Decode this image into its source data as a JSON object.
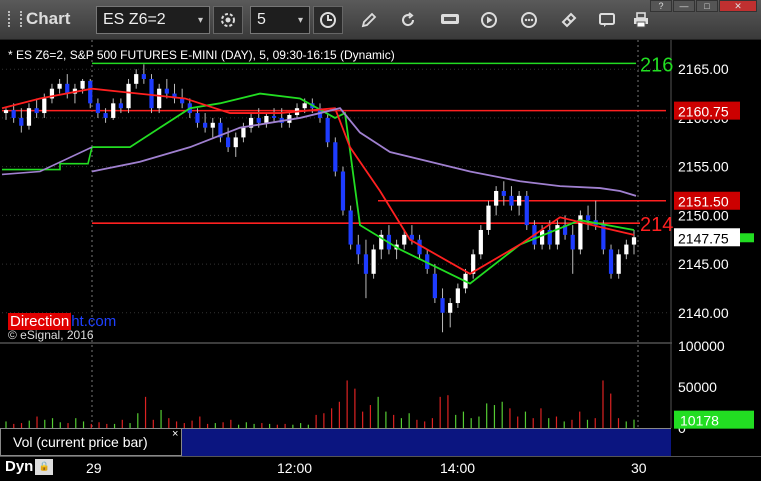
{
  "toolbar": {
    "title": "Chart",
    "symbol": "ES Z6=2",
    "interval": "5",
    "symbol_dropdown": "▾",
    "interval_dropdown": "▾"
  },
  "window_controls": {
    "help": "?",
    "minimize": "—",
    "maximize": "□",
    "close": "✕"
  },
  "legend": "* ES Z6=2, S&P 500 FUTURES E-MINI (DAY), 5, 09:30-16:15 (Dynamic)",
  "brand": {
    "part1": "Direction",
    "part2": "al.com",
    "overlay": "ht.com"
  },
  "copyright": "© eSignal, 2016",
  "price_axis": {
    "ticks": [
      "2165.00",
      "2160.00",
      "2155.00",
      "2150.00",
      "2145.00",
      "2140.00"
    ],
    "labels": [
      {
        "text": "2160.75",
        "color": "#e00000"
      },
      {
        "text": "2151.50",
        "color": "#e00000"
      },
      {
        "text": "2147.75",
        "color": "#ffffff"
      }
    ],
    "right_edge_labels": [
      {
        "text": "216",
        "color": "#22dd22"
      },
      {
        "text": "214",
        "color": "#ff2020"
      }
    ]
  },
  "volume_axis": {
    "ticks": [
      "100000",
      "50000",
      "0"
    ],
    "current": "10178"
  },
  "volume_tab": {
    "label": "Vol (current price bar)",
    "close": "×"
  },
  "bottom": {
    "dyn": "Dyn",
    "dyn_icon": "lock-icon",
    "x_labels": [
      "29",
      "12:00",
      "14:00",
      "30"
    ]
  },
  "colors": {
    "background": "#000000",
    "up_candle": "#ffffff",
    "down_candle": "#1e3cff",
    "red_line": "#ff2020",
    "green_line": "#22dd22",
    "purple_line": "#a080d0",
    "volume_tab_bar": "#0b1580"
  },
  "chart_data": {
    "type": "candlestick",
    "title": "ES Z6=2, S&P 500 FUTURES E-MINI (DAY), 5, 09:30-16:15 (Dynamic)",
    "ylim": [
      2137,
      2168
    ],
    "x_labels": [
      "29",
      "12:00",
      "14:00",
      "30"
    ],
    "horizontal_levels": [
      {
        "value": 2165.6,
        "color": "green"
      },
      {
        "value": 2160.75,
        "color": "red"
      },
      {
        "value": 2151.5,
        "color": "red"
      },
      {
        "value": 2149.2,
        "color": "red"
      }
    ],
    "last_price": 2147.75,
    "candles": [
      [
        2160.5,
        2161.0,
        2159.8,
        2160.8
      ],
      [
        2160.8,
        2161.5,
        2159.5,
        2160.0
      ],
      [
        2160.0,
        2161.0,
        2158.5,
        2159.2
      ],
      [
        2159.2,
        2161.5,
        2158.8,
        2161.0
      ],
      [
        2161.0,
        2162.0,
        2160.0,
        2160.5
      ],
      [
        2160.5,
        2162.5,
        2160.0,
        2162.0
      ],
      [
        2162.0,
        2163.5,
        2161.5,
        2163.0
      ],
      [
        2163.0,
        2164.0,
        2162.5,
        2163.5
      ],
      [
        2163.5,
        2164.5,
        2162.0,
        2162.5
      ],
      [
        2162.5,
        2163.5,
        2161.5,
        2163.0
      ],
      [
        2163.0,
        2164.0,
        2162.5,
        2163.8
      ],
      [
        2163.8,
        2164.0,
        2161.0,
        2161.5
      ],
      [
        2161.5,
        2162.0,
        2160.0,
        2160.5
      ],
      [
        2160.5,
        2161.0,
        2159.5,
        2160.0
      ],
      [
        2160.0,
        2162.0,
        2159.8,
        2161.5
      ],
      [
        2161.5,
        2162.0,
        2160.5,
        2161.0
      ],
      [
        2161.0,
        2164.0,
        2160.5,
        2163.5
      ],
      [
        2163.5,
        2165.0,
        2163.0,
        2164.5
      ],
      [
        2164.5,
        2165.5,
        2163.5,
        2164.0
      ],
      [
        2164.0,
        2164.5,
        2160.5,
        2161.0
      ],
      [
        2161.0,
        2163.5,
        2160.5,
        2163.0
      ],
      [
        2163.0,
        2164.0,
        2162.0,
        2162.5
      ],
      [
        2162.5,
        2163.5,
        2161.5,
        2162.0
      ],
      [
        2162.0,
        2163.0,
        2161.0,
        2161.5
      ],
      [
        2161.5,
        2162.0,
        2160.0,
        2160.5
      ],
      [
        2160.5,
        2161.0,
        2159.0,
        2159.5
      ],
      [
        2159.5,
        2160.5,
        2158.5,
        2159.0
      ],
      [
        2159.0,
        2160.0,
        2158.0,
        2159.5
      ],
      [
        2159.5,
        2160.0,
        2157.5,
        2158.0
      ],
      [
        2158.0,
        2159.0,
        2156.5,
        2157.0
      ],
      [
        2157.0,
        2158.5,
        2156.0,
        2158.0
      ],
      [
        2158.0,
        2159.5,
        2157.5,
        2159.0
      ],
      [
        2159.0,
        2160.5,
        2158.5,
        2160.0
      ],
      [
        2160.0,
        2161.0,
        2159.0,
        2159.5
      ],
      [
        2159.5,
        2160.5,
        2159.0,
        2160.2
      ],
      [
        2160.2,
        2161.0,
        2159.5,
        2160.0
      ],
      [
        2160.0,
        2161.0,
        2159.0,
        2159.5
      ],
      [
        2159.5,
        2160.5,
        2159.0,
        2160.3
      ],
      [
        2160.3,
        2161.5,
        2160.0,
        2161.0
      ],
      [
        2161.0,
        2162.0,
        2160.5,
        2161.5
      ],
      [
        2161.5,
        2162.0,
        2160.5,
        2161.0
      ],
      [
        2161.0,
        2161.5,
        2159.5,
        2160.0
      ],
      [
        2160.0,
        2160.5,
        2157.0,
        2157.5
      ],
      [
        2157.5,
        2158.0,
        2154.0,
        2154.5
      ],
      [
        2154.5,
        2155.0,
        2150.0,
        2150.5
      ],
      [
        2150.5,
        2151.0,
        2146.5,
        2147.0
      ],
      [
        2147.0,
        2148.0,
        2145.0,
        2146.0
      ],
      [
        2146.0,
        2147.5,
        2141.5,
        2144.0
      ],
      [
        2144.0,
        2147.0,
        2143.5,
        2146.5
      ],
      [
        2146.5,
        2148.5,
        2145.5,
        2148.0
      ],
      [
        2148.0,
        2149.0,
        2146.0,
        2146.5
      ],
      [
        2146.5,
        2147.5,
        2145.5,
        2147.0
      ],
      [
        2147.0,
        2148.5,
        2146.5,
        2148.0
      ],
      [
        2148.0,
        2149.0,
        2147.0,
        2147.5
      ],
      [
        2147.5,
        2148.0,
        2145.5,
        2146.0
      ],
      [
        2146.0,
        2146.5,
        2144.0,
        2144.5
      ],
      [
        2144.0,
        2145.0,
        2141.0,
        2141.5
      ],
      [
        2141.5,
        2142.5,
        2138.0,
        2140.0
      ],
      [
        2140.0,
        2141.5,
        2138.5,
        2141.0
      ],
      [
        2141.0,
        2143.0,
        2140.5,
        2142.5
      ],
      [
        2142.5,
        2144.5,
        2142.0,
        2144.0
      ],
      [
        2144.0,
        2146.5,
        2143.5,
        2146.0
      ],
      [
        2146.0,
        2149.0,
        2145.5,
        2148.5
      ],
      [
        2148.5,
        2151.5,
        2148.0,
        2151.0
      ],
      [
        2151.0,
        2153.0,
        2150.0,
        2152.5
      ],
      [
        2152.5,
        2153.5,
        2151.0,
        2152.0
      ],
      [
        2152.0,
        2153.0,
        2150.5,
        2151.0
      ],
      [
        2151.0,
        2152.5,
        2150.0,
        2152.0
      ],
      [
        2152.0,
        2152.5,
        2148.5,
        2149.0
      ],
      [
        2149.0,
        2149.5,
        2146.5,
        2147.0
      ],
      [
        2147.0,
        2149.0,
        2146.5,
        2148.5
      ],
      [
        2148.5,
        2149.5,
        2146.5,
        2147.0
      ],
      [
        2147.0,
        2149.5,
        2146.5,
        2149.0
      ],
      [
        2149.0,
        2150.0,
        2147.5,
        2148.0
      ],
      [
        2148.0,
        2149.0,
        2144.0,
        2146.5
      ],
      [
        2146.5,
        2150.5,
        2146.0,
        2150.0
      ],
      [
        2150.0,
        2151.0,
        2148.5,
        2149.5
      ],
      [
        2149.5,
        2151.5,
        2148.5,
        2149.0
      ],
      [
        2149.0,
        2149.5,
        2146.0,
        2146.5
      ],
      [
        2146.5,
        2147.0,
        2143.5,
        2144.0
      ],
      [
        2144.0,
        2146.5,
        2143.5,
        2146.0
      ],
      [
        2146.0,
        2147.5,
        2145.5,
        2147.0
      ],
      [
        2147.0,
        2148.5,
        2146.0,
        2147.75
      ]
    ],
    "volume": [
      8000,
      5000,
      6000,
      9000,
      14000,
      10000,
      12000,
      7000,
      6000,
      12000,
      8000,
      5000,
      7000,
      5000,
      5000,
      10000,
      6000,
      18000,
      38000,
      10000,
      22000,
      12000,
      8000,
      6000,
      9000,
      14000,
      5000,
      6000,
      7000,
      10000,
      4000,
      7000,
      5000,
      6000,
      5000,
      4000,
      5000,
      4000,
      6000,
      4000,
      16000,
      18000,
      24000,
      32000,
      58000,
      48000,
      20000,
      28000,
      38000,
      20000,
      16000,
      12000,
      18000,
      10000,
      8000,
      12000,
      38000,
      40000,
      16000,
      20000,
      12000,
      14000,
      30000,
      28000,
      32000,
      24000,
      14000,
      20000,
      12000,
      24000,
      12000,
      14000,
      8000,
      10000,
      20000,
      10000,
      12000,
      58000,
      42000,
      12000,
      8000,
      10178
    ],
    "series": [
      {
        "name": "",
        "color": "green",
        "values": [
          2157,
          2157,
          2159,
          2161,
          2161.5,
          2162.5,
          2162,
          2160,
          2160.5,
          2149,
          2146.5,
          2143,
          2147,
          2149.5,
          2148.5
        ]
      },
      {
        "name": "",
        "color": "red",
        "values": [
          2161,
          2162,
          2163,
          2162,
          2160.5,
          2160.5,
          2161,
          2157,
          2152.5,
          2147.5,
          2144,
          2147,
          2149.8,
          2148.8,
          2148
        ]
      },
      {
        "name": "",
        "color": "purple",
        "values": [
          2154.5,
          2155.5,
          2157,
          2159,
          2160,
          2161,
          2158.5,
          2156.5,
          2155.5,
          2154.5,
          2153.5,
          2153,
          2152.8,
          2152.5,
          2152
        ]
      }
    ]
  }
}
